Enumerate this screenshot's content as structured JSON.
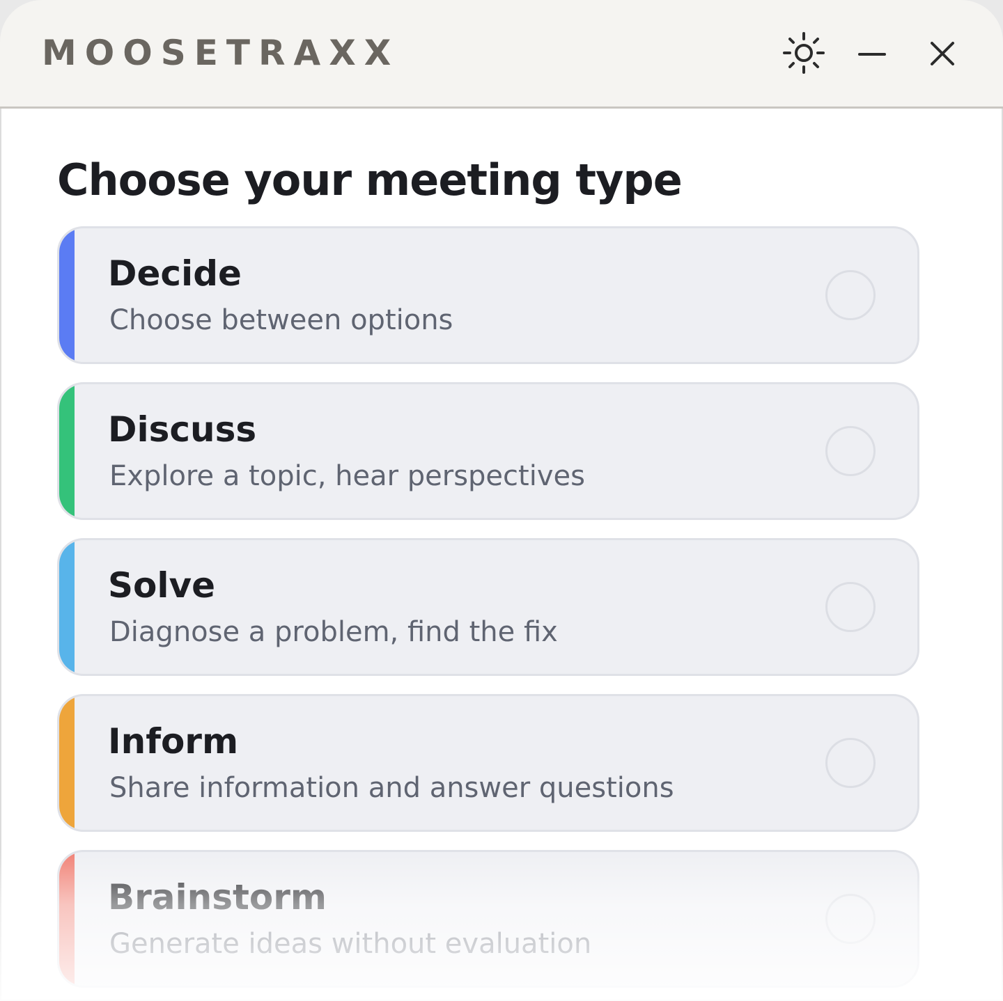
{
  "app": {
    "title": "MOOSETRAXX",
    "icons": {
      "theme": "sun-icon",
      "minimize": "minus-icon",
      "close": "close-icon"
    }
  },
  "main": {
    "heading": "Choose your meeting type",
    "meeting_types": [
      {
        "title": "Decide",
        "description": "Choose between options",
        "accent_color": "#5b7cf3",
        "selected": false
      },
      {
        "title": "Discuss",
        "description": "Explore a topic, hear perspectives",
        "accent_color": "#34c27a",
        "selected": false
      },
      {
        "title": "Solve",
        "description": "Diagnose a problem, find the fix",
        "accent_color": "#58b4ea",
        "selected": false
      },
      {
        "title": "Inform",
        "description": "Share information and answer questions",
        "accent_color": "#eea53b",
        "selected": false
      },
      {
        "title": "Brainstorm",
        "description": "Generate ideas without evaluation",
        "accent_color": "#f07e72",
        "selected": false
      }
    ]
  },
  "colors": {
    "titlebar_bg": "#f5f4f1",
    "card_bg": "#eeeff3",
    "heading_text": "#1c1d22",
    "description_text": "#5f6471"
  }
}
